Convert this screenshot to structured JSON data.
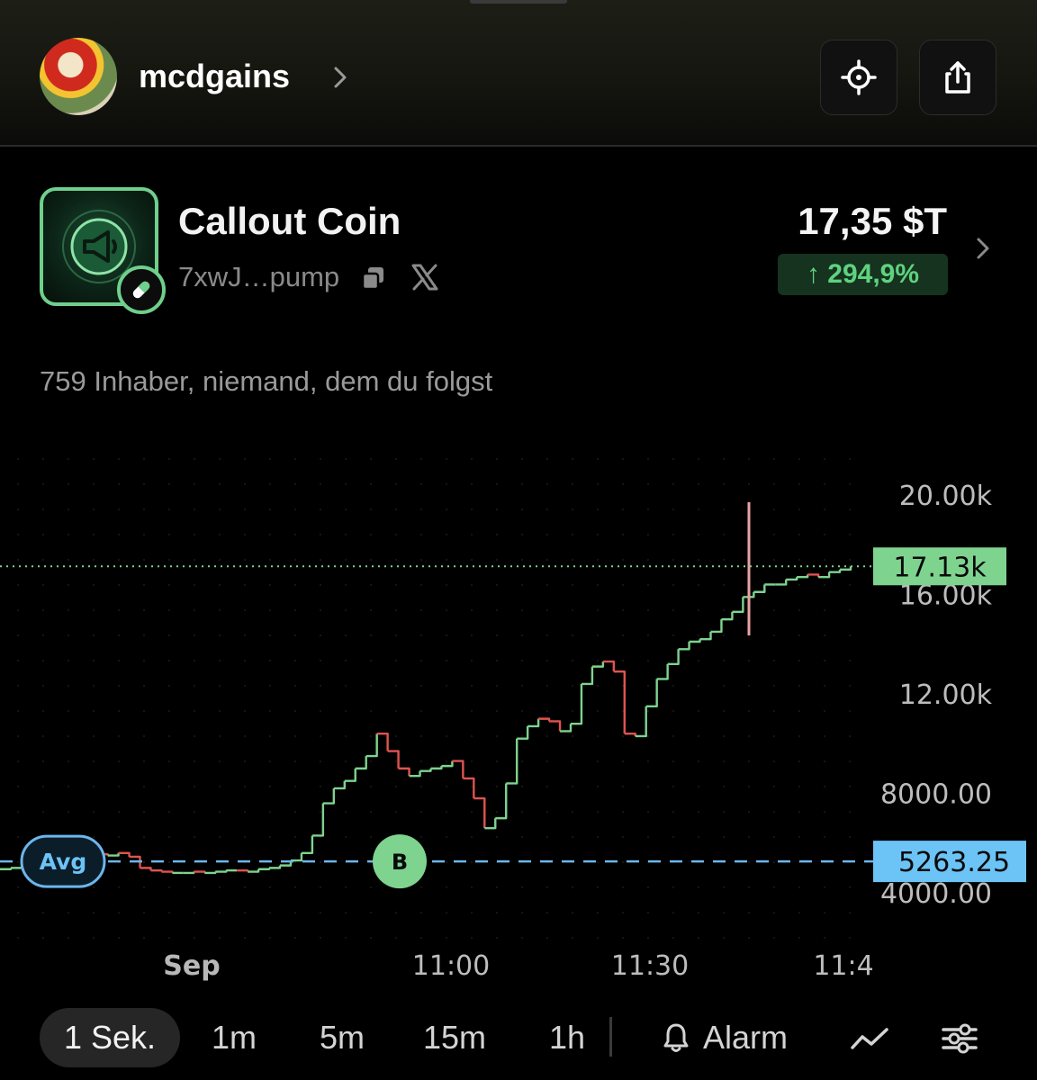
{
  "header": {
    "username": "mcdgains"
  },
  "coin": {
    "name": "Callout Coin",
    "address": "7xwJ…pump",
    "market_cap": "17,35 $T",
    "change": "↑ 294,9%",
    "accent_color": "#6fcf8c"
  },
  "holders_text": "759 Inhaber, niemand, dem du folgst",
  "chart_data": {
    "type": "line",
    "y_ticks": [
      "20.00k",
      "16.00k",
      "12.00k",
      "8000.00",
      "4000.00"
    ],
    "x_ticks": [
      "Sep",
      "11:00",
      "11:30",
      "11:4"
    ],
    "current_price_label": "17.13k",
    "current_price": 17130,
    "avg_price_label": "5263.25",
    "avg_price": 5263.25,
    "avg_label": "Avg",
    "buy_marker_label": "B",
    "ylim": [
      2500,
      21500
    ],
    "up_color": "#7ed38f",
    "down_color": "#e0544f",
    "series": [
      {
        "values": [
          4950,
          5000,
          5050,
          5100,
          5200,
          5300,
          5400,
          5450,
          5500,
          5550,
          5500,
          5600,
          5450,
          5000,
          4900,
          4850,
          4800,
          4800,
          4850,
          4800,
          4850,
          4900,
          4900,
          4850,
          4950,
          5000,
          5100,
          5300,
          5600,
          6300,
          7600,
          8200,
          8500,
          9000,
          9500,
          10400,
          9700,
          9000,
          8700,
          8900,
          9000,
          9100,
          9300,
          8600,
          7800,
          6600,
          7000,
          8400,
          10200,
          10700,
          11000,
          10900,
          10500,
          10800,
          12400,
          13100,
          13300,
          12900,
          10400,
          10300,
          11500,
          12600,
          13200,
          13800,
          14100,
          14200,
          14500,
          15000,
          15300,
          15900,
          16100,
          16400,
          16400,
          16600,
          16700,
          16800,
          16700,
          16900,
          17000,
          17130
        ]
      }
    ]
  },
  "timeframes": {
    "items": [
      "1 Sek.",
      "1m",
      "5m",
      "15m",
      "1h"
    ],
    "alarm": "Alarm"
  }
}
